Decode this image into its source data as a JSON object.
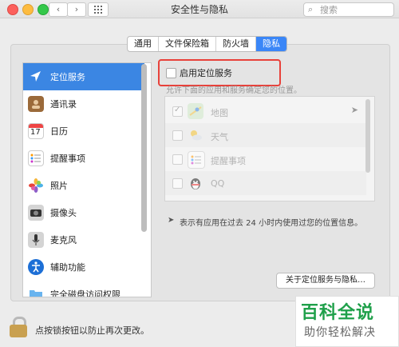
{
  "window": {
    "title": "安全性与隐私"
  },
  "search": {
    "placeholder": "搜索",
    "icon": "search-icon"
  },
  "nav": {
    "back": "‹",
    "forward": "›"
  },
  "tabs": [
    {
      "label": "通用",
      "active": false
    },
    {
      "label": "文件保险箱",
      "active": false
    },
    {
      "label": "防火墙",
      "active": false
    },
    {
      "label": "隐私",
      "active": true
    }
  ],
  "sidebar": {
    "items": [
      {
        "label": "定位服务",
        "icon": "location-arrow-icon",
        "active": true
      },
      {
        "label": "通讯录",
        "icon": "contacts-book-icon"
      },
      {
        "label": "日历",
        "icon": "calendar-icon",
        "day": "17"
      },
      {
        "label": "提醒事项",
        "icon": "reminders-icon"
      },
      {
        "label": "照片",
        "icon": "photos-icon"
      },
      {
        "label": "摄像头",
        "icon": "camera-icon"
      },
      {
        "label": "麦克风",
        "icon": "microphone-icon"
      },
      {
        "label": "辅助功能",
        "icon": "accessibility-icon"
      },
      {
        "label": "完全磁盘访问权限",
        "icon": "folder-icon"
      }
    ]
  },
  "location": {
    "enable_label": "启用定位服务",
    "enabled": false,
    "allow_text": "允许下面的应用和服务确定您的位置。",
    "apps": [
      {
        "name": "地图",
        "checked": true,
        "icon": "maps-icon",
        "recent": true
      },
      {
        "name": "天气",
        "checked": false,
        "icon": "weather-icon"
      },
      {
        "name": "提醒事项",
        "checked": false,
        "icon": "reminders-icon"
      },
      {
        "name": "QQ",
        "checked": false,
        "icon": "qq-penguin-icon"
      }
    ],
    "note": "表示有应用在过去 24 小时内使用过您的位置信息。",
    "about_button": "关于定位服务与隐私…"
  },
  "footer": {
    "lock_text": "点按锁按钮以防止再次更改。"
  },
  "watermark": {
    "title": "百科全说",
    "subtitle": "助你轻松解决"
  },
  "colors": {
    "accent": "#3b86e3",
    "highlight": "#e8413a",
    "watermark": "#1fa04a"
  }
}
